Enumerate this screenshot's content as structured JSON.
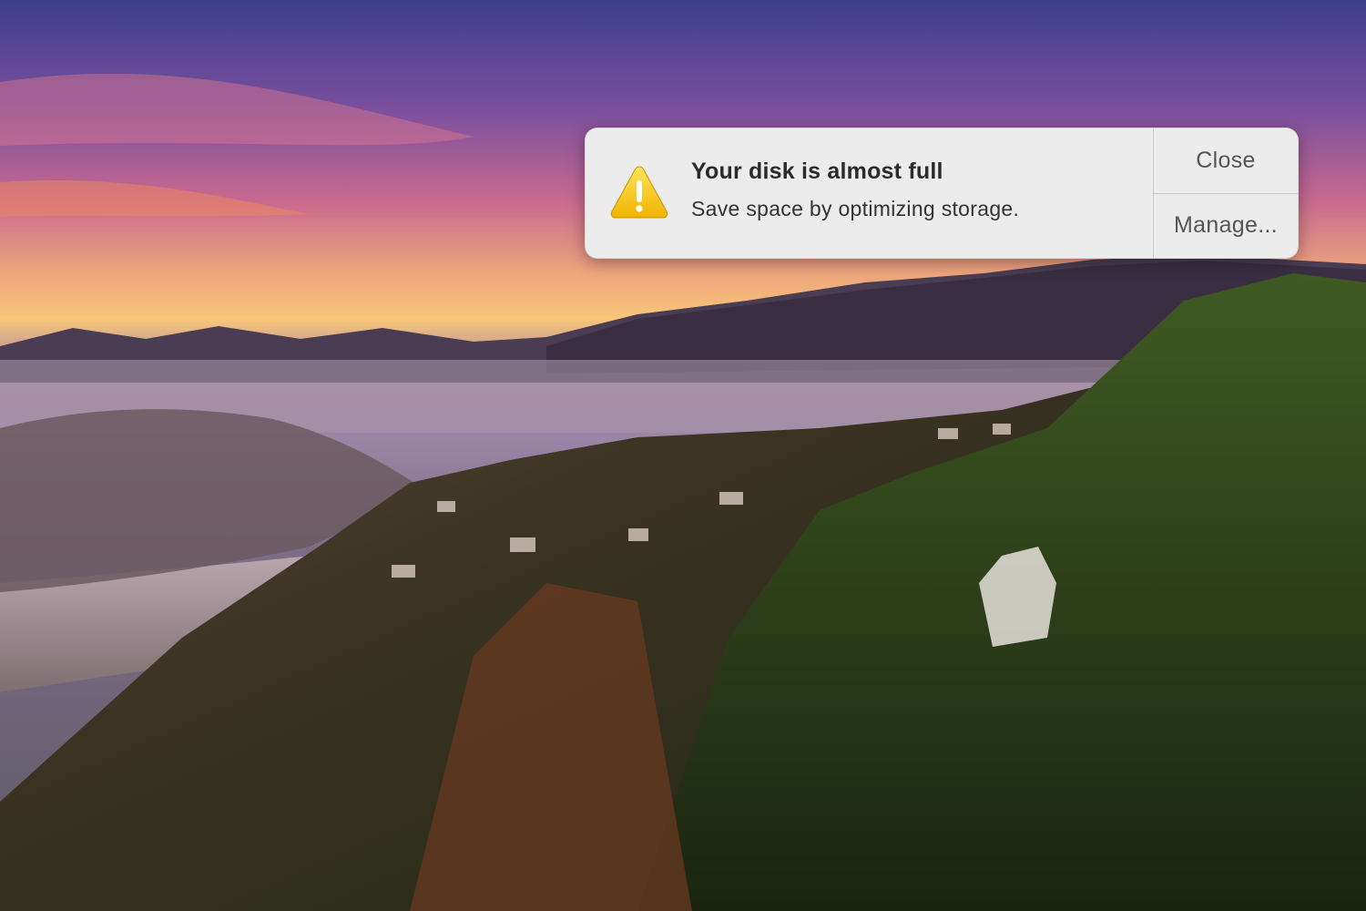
{
  "notification": {
    "icon": "warning-icon",
    "title": "Your disk is almost full",
    "subtitle": "Save space by optimizing storage.",
    "close_label": "Close",
    "manage_label": "Manage..."
  },
  "colors": {
    "panel_background": "#ececec",
    "warning_yellow": "#f5c400",
    "text_primary": "#2b2b2b",
    "button_text": "#555555"
  }
}
